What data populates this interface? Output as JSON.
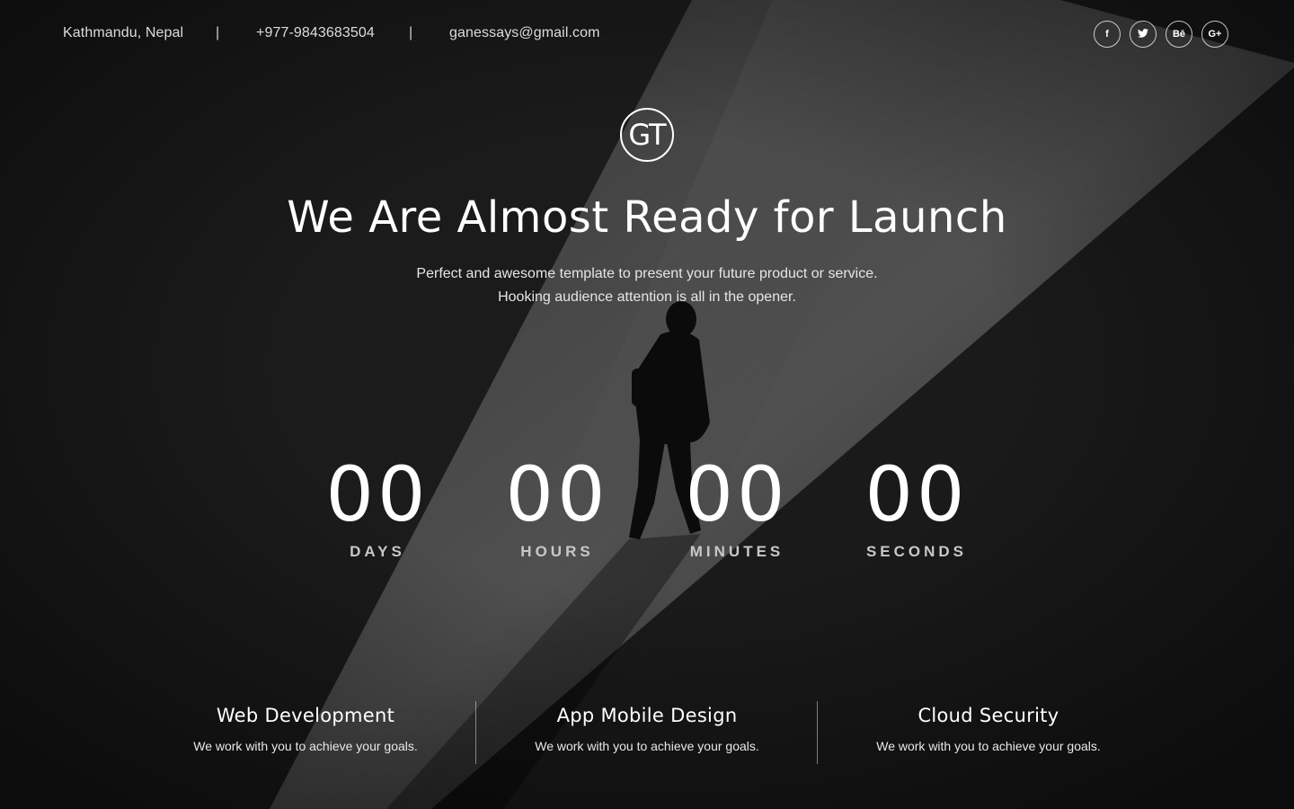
{
  "contact": {
    "location": "Kathmandu, Nepal",
    "phone": "+977-9843683504",
    "email": "ganessays@gmail.com",
    "separator": "|"
  },
  "socials": [
    {
      "icon": "facebook-icon",
      "glyph": "f"
    },
    {
      "icon": "twitter-icon",
      "glyph": "t"
    },
    {
      "icon": "behance-icon",
      "glyph": "Bē"
    },
    {
      "icon": "google-plus-icon",
      "glyph": "G+"
    }
  ],
  "logo": {
    "text": "GT"
  },
  "hero": {
    "title": "We Are Almost Ready for Launch",
    "line1": "Perfect and awesome template to present your future product or service.",
    "line2": "Hooking audience attention is all in the opener."
  },
  "countdown": [
    {
      "value": "00",
      "label": "DAYS"
    },
    {
      "value": "00",
      "label": "HOURS"
    },
    {
      "value": "00",
      "label": "MINUTES"
    },
    {
      "value": "00",
      "label": "SECONDS"
    }
  ],
  "services": [
    {
      "title": "Web Development",
      "desc": "We work with you to achieve your goals."
    },
    {
      "title": "App Mobile Design",
      "desc": "We work with you to achieve your goals."
    },
    {
      "title": "Cloud Security",
      "desc": "We work with you to achieve your goals."
    }
  ],
  "colors": {
    "text": "#ffffff",
    "label": "#c8c8c8",
    "background": "#141414"
  }
}
